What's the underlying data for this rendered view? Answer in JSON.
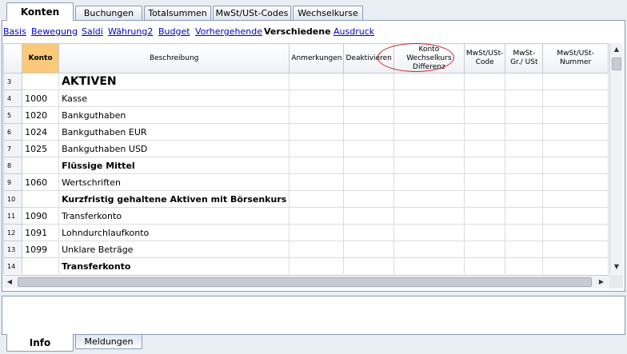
{
  "top_tabs": [
    {
      "label": "Konten",
      "active": true
    },
    {
      "label": "Buchungen",
      "active": false
    },
    {
      "label": "Totalsummen",
      "active": false
    },
    {
      "label": "MwSt/USt-Codes",
      "active": false
    },
    {
      "label": "Wechselkurse",
      "active": false
    }
  ],
  "views": [
    {
      "label": "Basis",
      "current": false
    },
    {
      "label": "Bewegung",
      "current": false
    },
    {
      "label": "Saldi",
      "current": false
    },
    {
      "label": "Währung2",
      "current": false
    },
    {
      "label": "Budget",
      "current": false
    },
    {
      "label": "Vorhergehende",
      "current": false
    },
    {
      "label": "Verschiedene",
      "current": true
    },
    {
      "label": "Ausdruck",
      "current": false
    }
  ],
  "columns": [
    "",
    "Konto",
    "Beschreibung",
    "Anmerkungen",
    "Deaktivieren",
    "Konto Wechselkurs Differenz",
    "MwSt/USt-Code",
    "MwSt-Gr./ USt",
    "MwSt/USt-Nummer"
  ],
  "rows": [
    {
      "n": "3",
      "konto": "",
      "beschreibung": "AKTIVEN",
      "style": "big"
    },
    {
      "n": "4",
      "konto": "1000",
      "beschreibung": "Kasse",
      "style": ""
    },
    {
      "n": "5",
      "konto": "1020",
      "beschreibung": "Bankguthaben",
      "style": ""
    },
    {
      "n": "6",
      "konto": "1024",
      "beschreibung": "Bankguthaben EUR",
      "style": ""
    },
    {
      "n": "7",
      "konto": "1025",
      "beschreibung": "Bankguthaben USD",
      "style": ""
    },
    {
      "n": "8",
      "konto": "",
      "beschreibung": "Flüssige Mittel",
      "style": "bold"
    },
    {
      "n": "9",
      "konto": "1060",
      "beschreibung": "Wertschriften",
      "style": ""
    },
    {
      "n": "10",
      "konto": "",
      "beschreibung": "Kurzfristig gehaltene Aktiven mit Börsenkurs",
      "style": "bold"
    },
    {
      "n": "11",
      "konto": "1090",
      "beschreibung": "Transferkonto",
      "style": ""
    },
    {
      "n": "12",
      "konto": "1091",
      "beschreibung": "Lohndurchlaufkonto",
      "style": ""
    },
    {
      "n": "13",
      "konto": "1099",
      "beschreibung": "Unklare Beträge",
      "style": ""
    },
    {
      "n": "14",
      "konto": "",
      "beschreibung": "Transferkonto",
      "style": "bold"
    }
  ],
  "bottom_tabs": [
    {
      "label": "Info",
      "active": true
    },
    {
      "label": "Meldungen",
      "active": false
    }
  ],
  "icons": {
    "scroll_up": "▲",
    "scroll_down": "▼",
    "scroll_left": "◀",
    "scroll_right": "▶"
  },
  "colors": {
    "konto_header": "#fbc97a",
    "highlight_ellipse": "#cc2222",
    "link": "#0000cc"
  }
}
